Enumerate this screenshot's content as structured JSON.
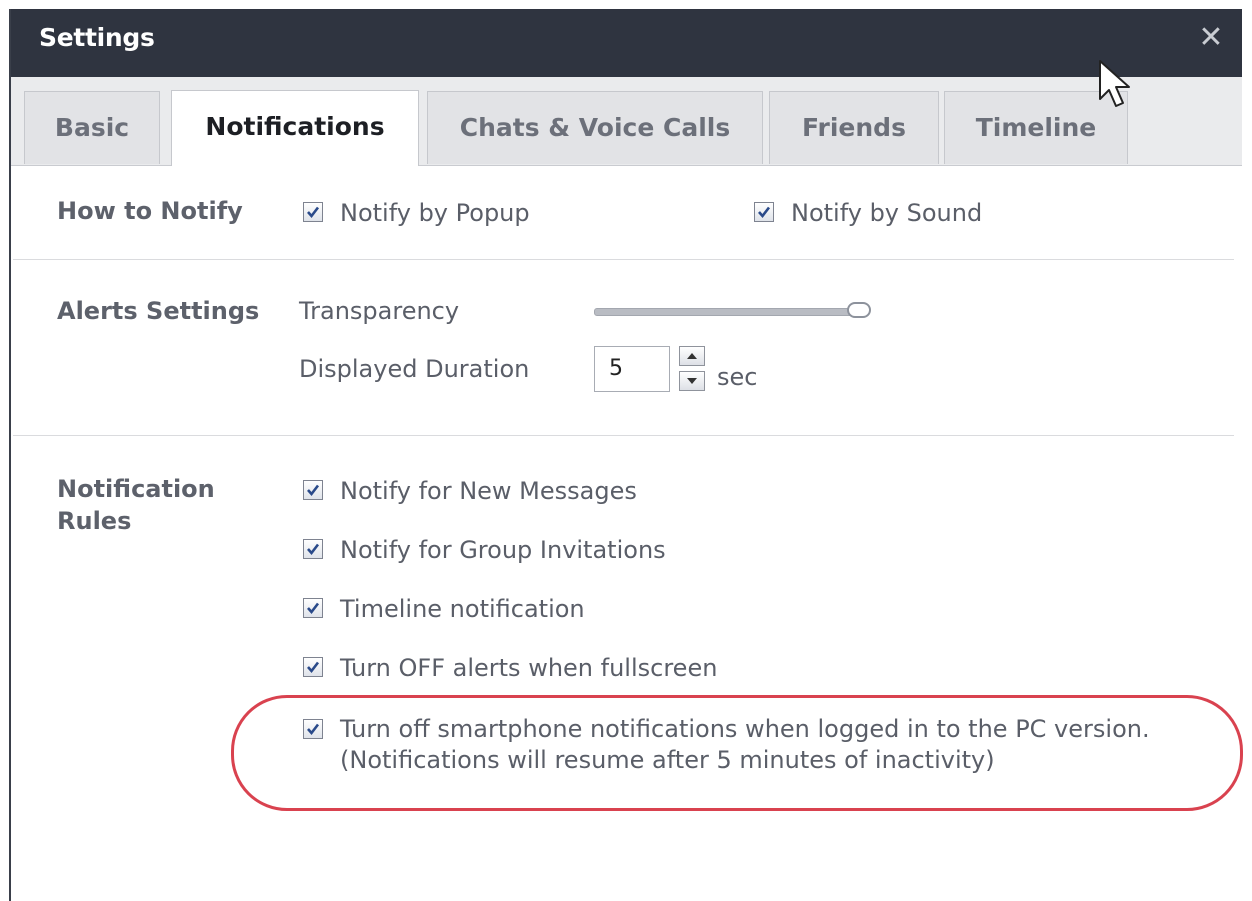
{
  "window": {
    "title": "Settings",
    "close_glyph": "✕"
  },
  "tabs": [
    {
      "label": "Basic",
      "active": false
    },
    {
      "label": "Notifications",
      "active": true
    },
    {
      "label": "Chats & Voice Calls",
      "active": false
    },
    {
      "label": "Friends",
      "active": false
    },
    {
      "label": "Timeline",
      "active": false
    }
  ],
  "how_to_notify": {
    "label": "How to Notify",
    "popup": {
      "label": "Notify by Popup",
      "checked": true
    },
    "sound": {
      "label": "Notify by Sound",
      "checked": true
    }
  },
  "alerts_settings": {
    "label": "Alerts Settings",
    "transparency": {
      "label": "Transparency",
      "value_fraction": 1.0
    },
    "duration": {
      "label": "Displayed Duration",
      "value": "5",
      "unit": "sec"
    }
  },
  "notification_rules": {
    "label_line1": "Notification",
    "label_line2": "Rules",
    "items": [
      {
        "label": "Notify for New Messages",
        "checked": true
      },
      {
        "label": "Notify for Group Invitations",
        "checked": true
      },
      {
        "label": "Timeline notification",
        "checked": true
      },
      {
        "label": "Turn OFF alerts when fullscreen",
        "checked": true
      },
      {
        "label": "Turn off smartphone notifications when logged in to the PC version.",
        "label_line2": "(Notifications will resume after 5 minutes of inactivity)",
        "checked": true
      }
    ]
  },
  "colors": {
    "titlebar": "#2f3440",
    "highlight": "#d9424f",
    "checkmark": "#2a4a8a"
  },
  "icons": {
    "close": "close-icon",
    "check": "checkmark-icon",
    "cursor": "mouse-pointer-icon"
  }
}
